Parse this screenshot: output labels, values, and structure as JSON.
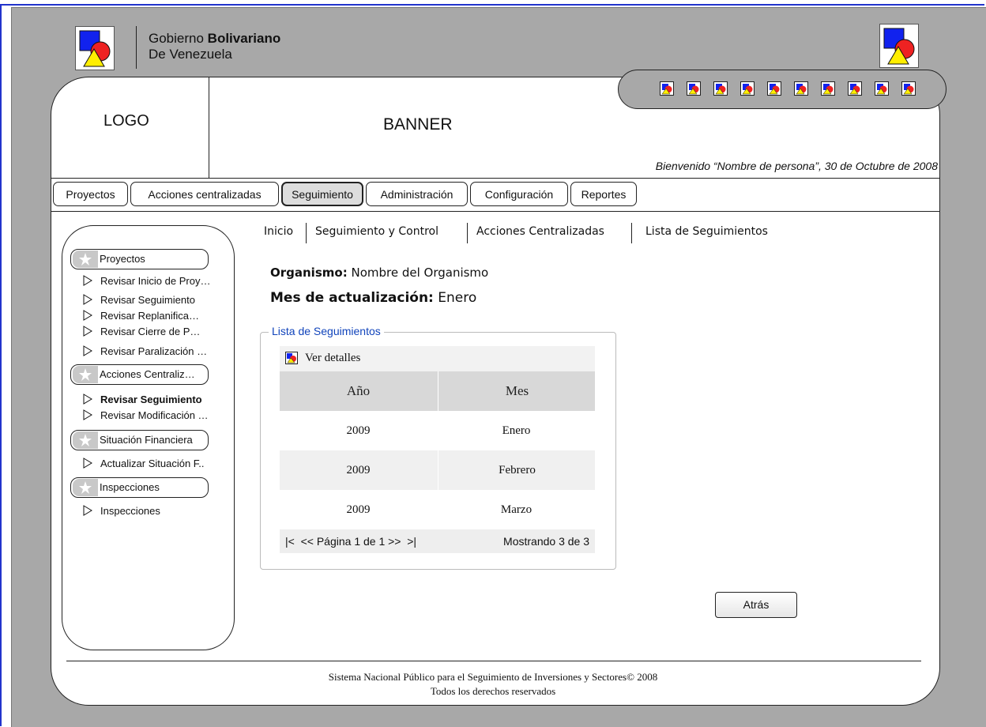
{
  "header": {
    "gov_line1_normal": "Gobierno ",
    "gov_line1_bold": "Bolivariano",
    "gov_line2": "De Venezuela"
  },
  "top": {
    "logo": "LOGO",
    "banner": "BANNER",
    "welcome": "Bienvenido “Nombre de persona”, 30 de Octubre de 2008",
    "quick_icons_count": 10
  },
  "menu": {
    "tabs": [
      "Proyectos",
      "Acciones centralizadas",
      "Seguimiento",
      "Administración",
      "Configuración",
      "Reportes"
    ],
    "active": "Seguimiento"
  },
  "sidebar": {
    "sections": [
      {
        "label": "Proyectos",
        "items": [
          {
            "label": "Revisar Inicio de Proy…",
            "bold": false
          },
          {
            "label": "Revisar Seguimiento",
            "bold": false
          },
          {
            "label": "Revisar Replanifica…",
            "bold": false
          },
          {
            "label": "Revisar Cierre de P…",
            "bold": false
          },
          {
            "label": "Revisar Paralización …",
            "bold": false
          }
        ]
      },
      {
        "label": "Acciones Centraliz…",
        "items": [
          {
            "label": "Revisar Seguimiento",
            "bold": true
          },
          {
            "label": "Revisar Modificación …",
            "bold": false
          }
        ]
      },
      {
        "label": "Situación Financiera",
        "items": [
          {
            "label": "Actualizar Situación F..",
            "bold": false
          }
        ]
      },
      {
        "label": "Inspecciones",
        "items": [
          {
            "label": "Inspecciones",
            "bold": false
          }
        ]
      }
    ]
  },
  "breadcrumb": [
    "Inicio",
    "Seguimiento y Control",
    "Acciones Centralizadas",
    "Lista de Seguimientos"
  ],
  "info": {
    "organismo_label": "Organismo:",
    "organismo_value": " Nombre del Organismo",
    "mes_label": "Mes de actualización:",
    "mes_value": " Enero"
  },
  "list": {
    "legend": "Lista de Seguimientos",
    "action": "Ver detalles",
    "columns": [
      "Año",
      "Mes"
    ],
    "rows": [
      [
        "2009",
        "Enero"
      ],
      [
        "2009",
        "Febrero"
      ],
      [
        "2009",
        "Marzo"
      ]
    ],
    "pager": "|<  << Página 1 de 1 >>  >|",
    "showing": "Mostrando 3 de 3"
  },
  "back_button": "Atrás",
  "footer": {
    "line1": "Sistema Nacional Público para el Seguimiento de Inversiones y Sectores© 2008",
    "line2": "Todos los derechos reservados"
  }
}
